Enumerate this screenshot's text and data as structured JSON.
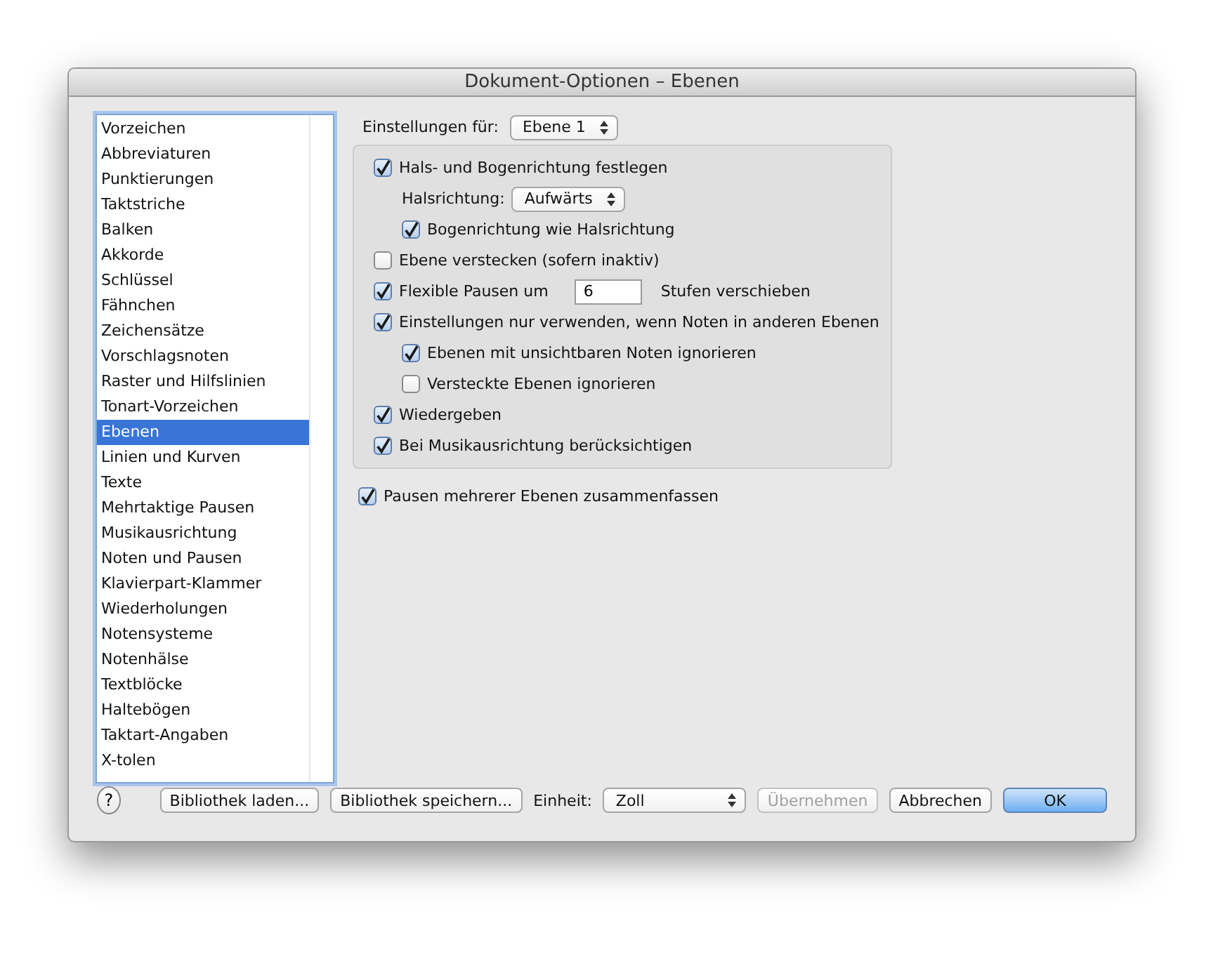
{
  "window": {
    "title": "Dokument-Optionen – Ebenen"
  },
  "sidebar": {
    "items": [
      {
        "label": "Vorzeichen",
        "selected": false
      },
      {
        "label": "Abbreviaturen",
        "selected": false
      },
      {
        "label": "Punktierungen",
        "selected": false
      },
      {
        "label": "Taktstriche",
        "selected": false
      },
      {
        "label": "Balken",
        "selected": false
      },
      {
        "label": "Akkorde",
        "selected": false
      },
      {
        "label": "Schlüssel",
        "selected": false
      },
      {
        "label": "Fähnchen",
        "selected": false
      },
      {
        "label": "Zeichensätze",
        "selected": false
      },
      {
        "label": "Vorschlagsnoten",
        "selected": false
      },
      {
        "label": "Raster und Hilfslinien",
        "selected": false
      },
      {
        "label": "Tonart-Vorzeichen",
        "selected": false
      },
      {
        "label": "Ebenen",
        "selected": true
      },
      {
        "label": "Linien und Kurven",
        "selected": false
      },
      {
        "label": "Texte",
        "selected": false
      },
      {
        "label": "Mehrtaktige Pausen",
        "selected": false
      },
      {
        "label": "Musikausrichtung",
        "selected": false
      },
      {
        "label": "Noten und Pausen",
        "selected": false
      },
      {
        "label": "Klavierpart-Klammer",
        "selected": false
      },
      {
        "label": "Wiederholungen",
        "selected": false
      },
      {
        "label": "Notensysteme",
        "selected": false
      },
      {
        "label": "Notenhälse",
        "selected": false
      },
      {
        "label": "Textblöcke",
        "selected": false
      },
      {
        "label": "Haltebögen",
        "selected": false
      },
      {
        "label": "Taktart-Angaben",
        "selected": false
      },
      {
        "label": "X-tolen",
        "selected": false
      }
    ]
  },
  "settings_for": {
    "label": "Einstellungen für:",
    "value": "Ebene 1"
  },
  "options": [
    {
      "kind": "checkbox",
      "label": "Hals- und Bogenrichtung festlegen",
      "checked": true,
      "children": [
        {
          "kind": "select",
          "label": "Halsrichtung:",
          "value": "Aufwärts"
        },
        {
          "kind": "checkbox",
          "label": "Bogenrichtung wie Halsrichtung",
          "checked": true
        }
      ]
    },
    {
      "kind": "checkbox",
      "label": "Ebene verstecken (sofern inaktiv)",
      "checked": false
    },
    {
      "kind": "number",
      "label": "Flexible Pausen um",
      "checked": true,
      "value": "6",
      "suffix": "Stufen verschieben"
    },
    {
      "kind": "checkbox",
      "label": "Einstellungen nur verwenden, wenn Noten in anderen Ebenen",
      "checked": true,
      "children": [
        {
          "kind": "checkbox",
          "label": "Ebenen mit unsichtbaren Noten ignorieren",
          "checked": true
        },
        {
          "kind": "checkbox",
          "label": "Versteckte Ebenen ignorieren",
          "checked": false
        }
      ]
    },
    {
      "kind": "checkbox",
      "label": "Wiedergeben",
      "checked": true
    },
    {
      "kind": "checkbox",
      "label": "Bei Musikausrichtung berücksichtigen",
      "checked": true
    }
  ],
  "merge_rests": {
    "label": "Pausen mehrerer Ebenen zusammenfassen",
    "checked": true
  },
  "footer": {
    "help": "?",
    "load": "Bibliothek laden...",
    "save": "Bibliothek speichern...",
    "unit_label": "Einheit:",
    "unit": "Zoll",
    "buttons": [
      {
        "label": "Übernehmen",
        "disabled": true,
        "default": false
      },
      {
        "label": "Abbrechen",
        "disabled": false,
        "default": false
      },
      {
        "label": "OK",
        "disabled": false,
        "default": true
      }
    ]
  }
}
